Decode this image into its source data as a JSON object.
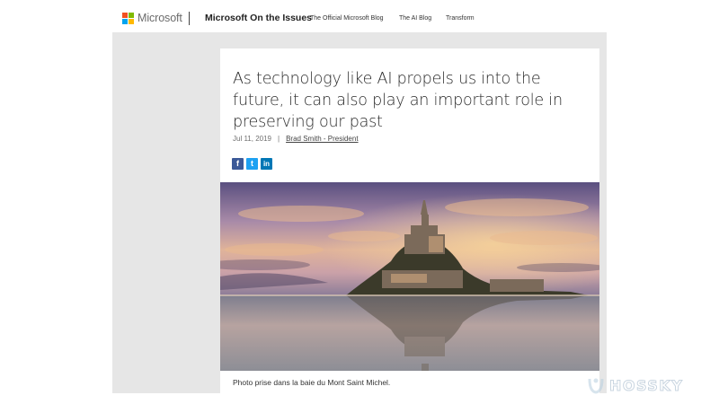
{
  "header": {
    "brand": "Microsoft",
    "site_title": "Microsoft On the Issues",
    "nav": [
      "The Official Microsoft Blog",
      "The AI Blog",
      "Transform"
    ],
    "logo_colors": [
      "#f25022",
      "#7fba00",
      "#00a4ef",
      "#ffb900"
    ]
  },
  "article": {
    "headline": "As technology like AI propels us into the future, it can also play an important role in preserving our past",
    "date": "Jul 11, 2019",
    "separator": "|",
    "author": "Brad Smith - President",
    "share": [
      {
        "name": "facebook-icon",
        "glyph": "f",
        "color": "#3b5998"
      },
      {
        "name": "twitter-icon",
        "glyph": "t",
        "color": "#1da1f2"
      },
      {
        "name": "linkedin-icon",
        "glyph": "in",
        "color": "#0077b5"
      }
    ],
    "image": {
      "subject": "mont-saint-michel-photo"
    },
    "caption": "Photo prise dans la baie du Mont Saint Michel."
  },
  "watermark": {
    "text": "HOSSKY"
  }
}
